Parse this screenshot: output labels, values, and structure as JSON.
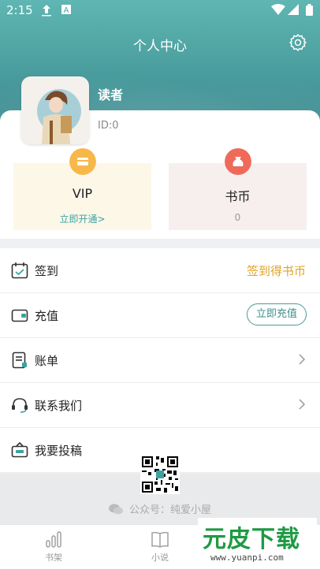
{
  "status_bar": {
    "time": "2:15",
    "upload_icon": "upload-arrow-icon",
    "a_icon": "font-a-icon",
    "wifi_icon": "wifi-icon",
    "signal_icon": "signal-icon",
    "battery_icon": "battery-icon"
  },
  "header": {
    "title": "个人中心",
    "settings_icon": "gear-icon",
    "bg_color": "#4fa3a2"
  },
  "profile": {
    "name": "读者",
    "id_text": "ID:0",
    "avatar_icon": "avatar"
  },
  "vip": {
    "label": "VIP",
    "action": "立即开通>",
    "icon_color": "#f7b84a",
    "action_color": "#3aa3a2"
  },
  "coins": {
    "label": "书币",
    "value": "0",
    "icon_color": "#f06a5a"
  },
  "menu": [
    {
      "icon": "calendar-icon",
      "label": "签到",
      "right": "签到得书币",
      "right_color": "#e0a32a"
    },
    {
      "icon": "wallet-icon",
      "label": "充值",
      "button": "立即充值"
    },
    {
      "icon": "bill-icon",
      "label": "账单"
    },
    {
      "icon": "headset-icon",
      "label": "联系我们"
    },
    {
      "icon": "submit-icon",
      "label": "我要投稿"
    }
  ],
  "footer": {
    "wechat_text": "公众号：纯爱小屋",
    "qr_icon": "qr-code"
  },
  "tabs": [
    {
      "label": "书架",
      "icon": "bars-icon"
    },
    {
      "label": "小说",
      "icon": "book-icon"
    }
  ],
  "watermark": {
    "text": "元皮下载",
    "url": "www.yuanpi.com"
  }
}
